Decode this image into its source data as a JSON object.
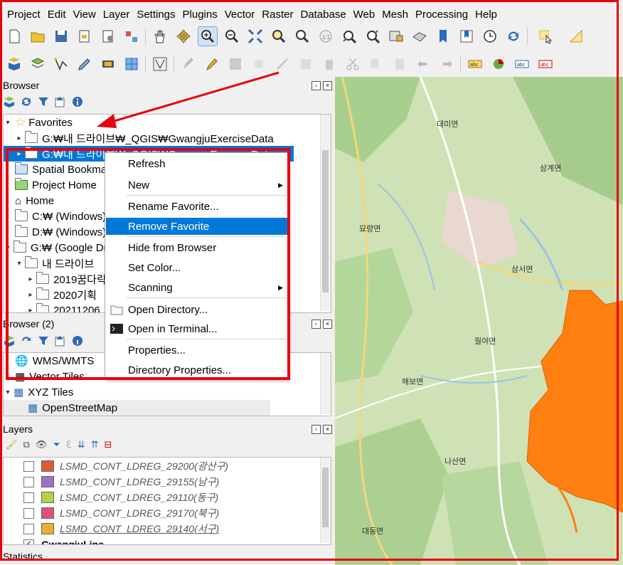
{
  "menubar": [
    "Project",
    "Edit",
    "View",
    "Layer",
    "Settings",
    "Plugins",
    "Vector",
    "Raster",
    "Database",
    "Web",
    "Mesh",
    "Processing",
    "Help"
  ],
  "browser_panel": {
    "title": "Browser",
    "items": [
      {
        "label": "Favorites"
      },
      {
        "label": "G:₩내 드라이브₩_QGIS₩GwangjuExerciseData"
      },
      {
        "label": "G:₩내 드라이브₩_QGIS₩GwangjuExerciseData"
      },
      {
        "label": "Spatial Bookmarks"
      },
      {
        "label": "Project Home"
      },
      {
        "label": "Home"
      },
      {
        "label": "C:₩ (Windows)"
      },
      {
        "label": "D:₩ (Windows)"
      },
      {
        "label": "G:₩ (Google Drive)"
      },
      {
        "label": "내 드라이브"
      },
      {
        "label": "2019꿈다락"
      },
      {
        "label": "2020기획"
      },
      {
        "label": "20211206"
      }
    ]
  },
  "browser2_panel": {
    "title": "Browser (2)",
    "items": [
      {
        "label": "WMS/WMTS"
      },
      {
        "label": "Vector Tiles"
      },
      {
        "label": "XYZ Tiles"
      },
      {
        "label": "OpenStreetMap"
      }
    ]
  },
  "context_menu": {
    "items": [
      {
        "label": "Refresh"
      },
      {
        "label": "New"
      },
      {
        "label": "Rename Favorite..."
      },
      {
        "label": "Remove Favorite"
      },
      {
        "label": "Hide from Browser"
      },
      {
        "label": "Set Color..."
      },
      {
        "label": "Scanning"
      },
      {
        "label": "Open Directory..."
      },
      {
        "label": "Open in Terminal..."
      },
      {
        "label": "Properties..."
      },
      {
        "label": "Directory Properties..."
      }
    ]
  },
  "layers_panel": {
    "title": "Layers",
    "layers": [
      {
        "name": "LSMD_CONT_LDREG_29200(광산구)",
        "color": "#e05a36"
      },
      {
        "name": "LSMD_CONT_LDREG_29155(남구)",
        "color": "#9b72c8"
      },
      {
        "name": "LSMD_CONT_LDREG_29110(동구)",
        "color": "#b5d044"
      },
      {
        "name": "LSMD_CONT_LDREG_29170(북구)",
        "color": "#e0507a"
      },
      {
        "name": "LSMD_CONT_LDREG_29140(서구)",
        "color": "#e8b030"
      },
      {
        "name": "GwangjuLine",
        "color": "#ffffff"
      }
    ]
  },
  "statistics_panel": {
    "title": "Statistics"
  },
  "map": {
    "towns": [
      "대미면",
      "삼계면",
      "묘량면",
      "삼서면",
      "월야면",
      "해보면",
      "나산면",
      "대동면"
    ],
    "overlay_color": "#ff7f11"
  },
  "colors": {
    "accent": "#e8000f",
    "selection": "#0078d7"
  }
}
